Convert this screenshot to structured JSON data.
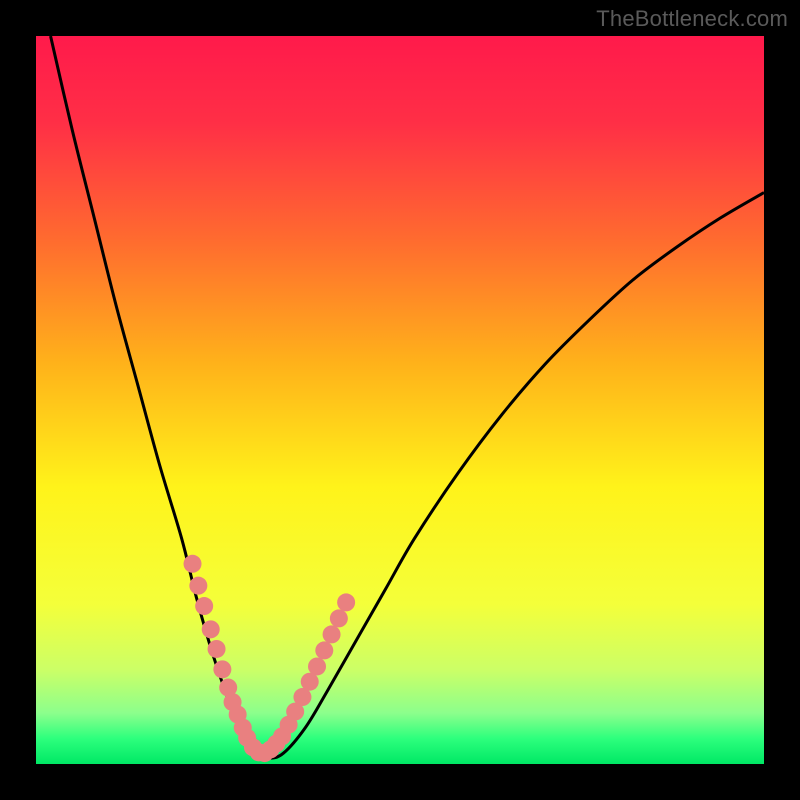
{
  "watermark": "TheBottleneck.com",
  "chart_data": {
    "type": "line",
    "title": "",
    "xlabel": "",
    "ylabel": "",
    "xlim": [
      0,
      100
    ],
    "ylim": [
      0,
      100
    ],
    "grid": false,
    "series": [
      {
        "name": "curve",
        "x": [
          2,
          5,
          8,
          11,
          14,
          17,
          20,
          22,
          24,
          26,
          27.5,
          29,
          30.5,
          32,
          34,
          37,
          40,
          44,
          48,
          52,
          58,
          64,
          70,
          76,
          82,
          88,
          94,
          100
        ],
        "y": [
          100,
          87,
          75,
          63,
          52,
          41,
          31,
          23,
          16,
          10,
          6,
          3,
          1.5,
          0.8,
          1.5,
          5,
          10,
          17,
          24,
          31,
          40,
          48,
          55,
          61,
          66.5,
          71,
          75,
          78.5
        ]
      }
    ],
    "marker_clusters": [
      {
        "name": "left-lobe-dots",
        "x": [
          21.5,
          22.3,
          23.1,
          24.0,
          24.8,
          25.6,
          26.4,
          27.0,
          27.7,
          28.4
        ],
        "y": [
          27.5,
          24.5,
          21.7,
          18.5,
          15.8,
          13.0,
          10.5,
          8.5,
          6.8,
          5.0
        ]
      },
      {
        "name": "right-lobe-dots",
        "x": [
          33.8,
          34.7,
          35.6,
          36.6,
          37.6,
          38.6,
          39.6,
          40.6,
          41.6,
          42.6
        ],
        "y": [
          3.8,
          5.4,
          7.2,
          9.2,
          11.3,
          13.4,
          15.6,
          17.8,
          20.0,
          22.2
        ]
      },
      {
        "name": "valley-dots",
        "x": [
          29.0,
          29.8,
          30.6,
          31.4,
          32.2,
          33.0
        ],
        "y": [
          3.6,
          2.3,
          1.6,
          1.5,
          2.0,
          2.8
        ]
      }
    ],
    "gradient_stops": [
      {
        "offset": 0.0,
        "color": "#ff1a4b"
      },
      {
        "offset": 0.12,
        "color": "#ff2f46"
      },
      {
        "offset": 0.28,
        "color": "#ff6b2f"
      },
      {
        "offset": 0.45,
        "color": "#ffb21a"
      },
      {
        "offset": 0.62,
        "color": "#fff31a"
      },
      {
        "offset": 0.78,
        "color": "#f4ff3a"
      },
      {
        "offset": 0.87,
        "color": "#ccff66"
      },
      {
        "offset": 0.93,
        "color": "#8cff8c"
      },
      {
        "offset": 0.965,
        "color": "#2dff7d"
      },
      {
        "offset": 1.0,
        "color": "#00e865"
      }
    ],
    "curve_color": "#000000",
    "marker_color": "#e98080",
    "marker_radius_px": 9
  }
}
